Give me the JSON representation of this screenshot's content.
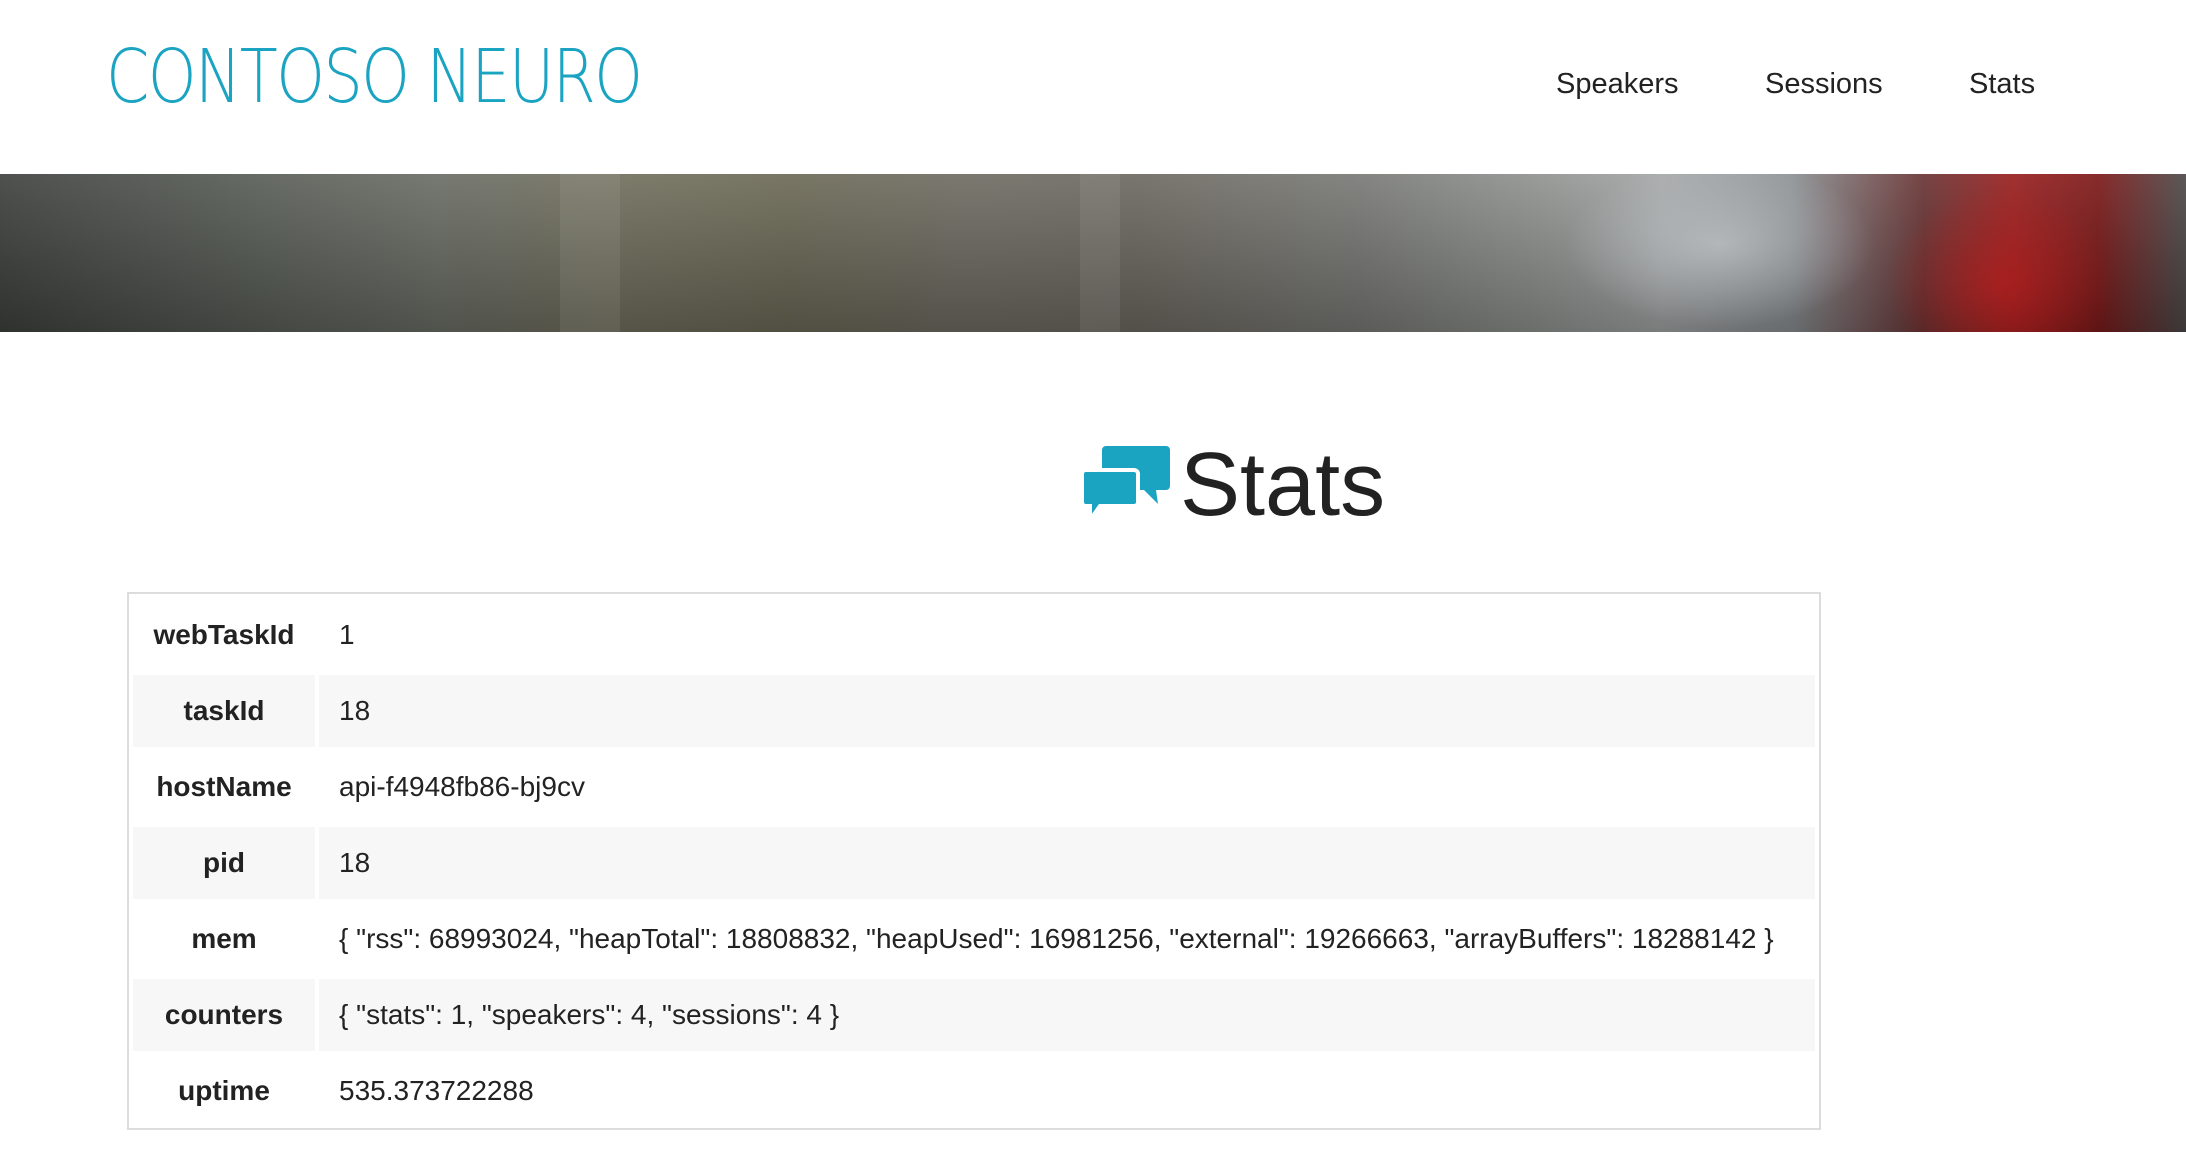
{
  "header": {
    "logo_text": "CONTOSO NEURO",
    "nav": [
      {
        "label": "Speakers"
      },
      {
        "label": "Sessions"
      },
      {
        "label": "Stats"
      }
    ]
  },
  "colors": {
    "brand": "#1ba3c2",
    "text": "#222222",
    "stripe": "#f7f7f7",
    "table_border": "#dcdcdc"
  },
  "main": {
    "title": "Stats",
    "title_icon": "chat-bubbles-icon",
    "stats": [
      {
        "key": "webTaskId",
        "value": "1"
      },
      {
        "key": "taskId",
        "value": "18"
      },
      {
        "key": "hostName",
        "value": "api-f4948fb86-bj9cv"
      },
      {
        "key": "pid",
        "value": "18"
      },
      {
        "key": "mem",
        "value": "{ \"rss\": 68993024, \"heapTotal\": 18808832, \"heapUsed\": 16981256, \"external\": 19266663, \"arrayBuffers\": 18288142 }"
      },
      {
        "key": "counters",
        "value": "{ \"stats\": 1, \"speakers\": 4, \"sessions\": 4 }"
      },
      {
        "key": "uptime",
        "value": "535.373722288"
      }
    ]
  }
}
